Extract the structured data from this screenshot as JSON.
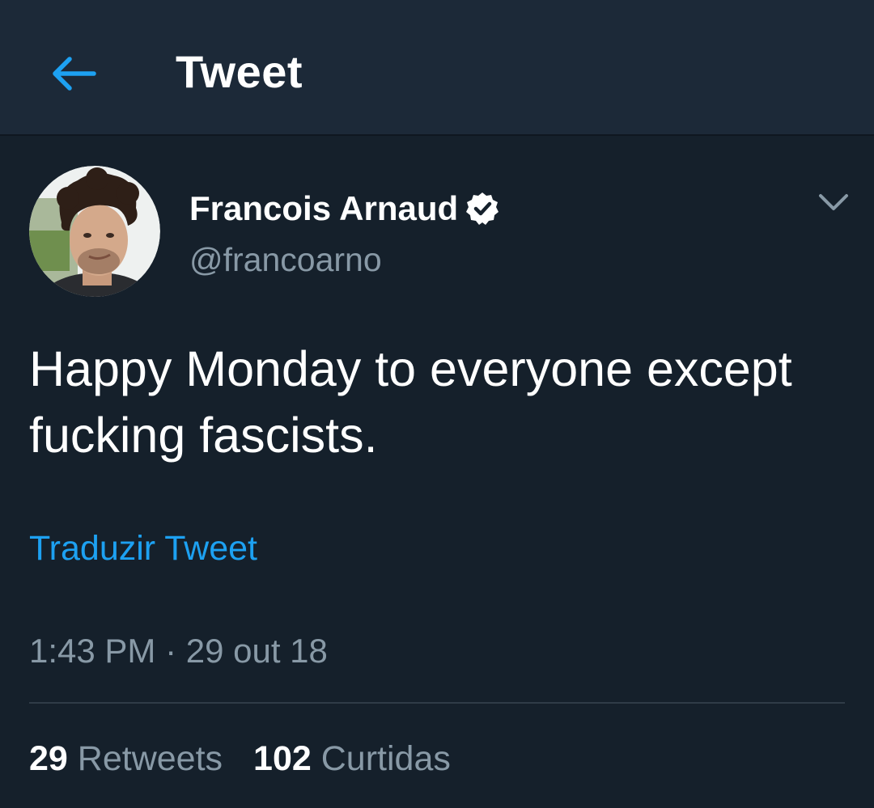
{
  "header": {
    "title": "Tweet",
    "back_icon": "arrow-left-icon"
  },
  "colors": {
    "background": "#15202b",
    "header_background": "#1c2938",
    "accent": "#1da1f2",
    "secondary_text": "#8899a6",
    "primary_text": "#ffffff"
  },
  "tweet": {
    "author": {
      "display_name": "Francois Arnaud",
      "handle": "@francoarno",
      "verified": true,
      "verified_icon": "verified-badge-icon",
      "avatar_icon": "profile-photo"
    },
    "menu_icon": "chevron-down-icon",
    "text": "Happy Monday to everyone except fucking fascists.",
    "translate_label": "Traduzir Tweet",
    "timestamp": "1:43 PM · 29 out 18",
    "stats": {
      "retweets_count": "29",
      "retweets_label": "Retweets",
      "likes_count": "102",
      "likes_label": "Curtidas"
    }
  }
}
